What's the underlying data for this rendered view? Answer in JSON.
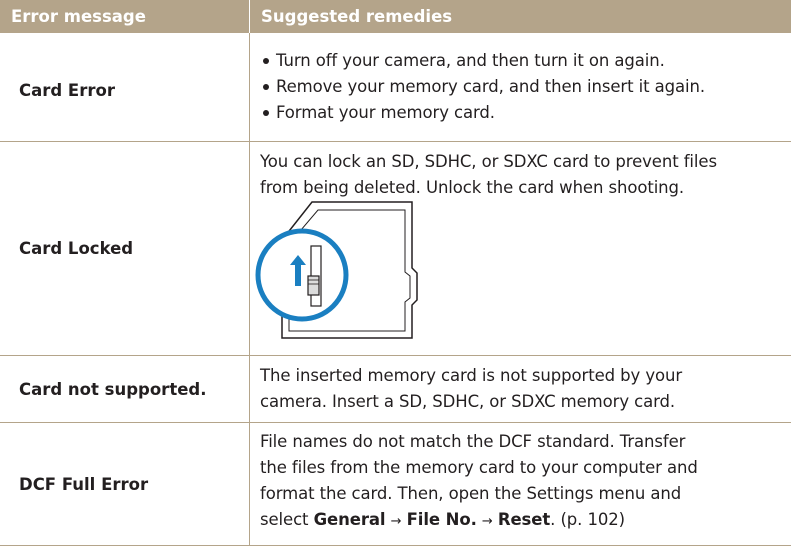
{
  "header": {
    "col1": "Error message",
    "col2": "Suggested remedies"
  },
  "rows": [
    {
      "error": "Card Error",
      "remedies": [
        "Turn off your camera, and then turn it on again.",
        "Remove your memory card, and then insert it again.",
        "Format your memory card."
      ]
    },
    {
      "error": "Card Locked",
      "remedy_line1": "You can lock an SD, SDHC, or SDXC card to prevent files",
      "remedy_line2": "from being deleted. Unlock the card when shooting.",
      "illustration_icon": "sd-card-lock-switch-icon"
    },
    {
      "error": "Card not supported.",
      "remedy_line1": "The inserted memory card is not supported by your",
      "remedy_line2": "camera. Insert a SD, SDHC, or SDXC memory card."
    },
    {
      "error": "DCF Full Error",
      "remedy_line1": "File names do not match the DCF standard. Transfer",
      "remedy_line2": "the files from the memory card to your computer and",
      "remedy_line3": "format the card. Then, open the Settings menu and",
      "remedy_line4_pre": "select",
      "menu1": "General",
      "arrow": "→",
      "menu2": "File No.",
      "menu3": "Reset",
      "remedy_line4_post": ". (p. 102)"
    }
  ],
  "colors": {
    "header_bg": "#b4a48a",
    "rule": "#b4a48a",
    "accent_blue": "#1a7fc1",
    "text": "#231f20"
  }
}
